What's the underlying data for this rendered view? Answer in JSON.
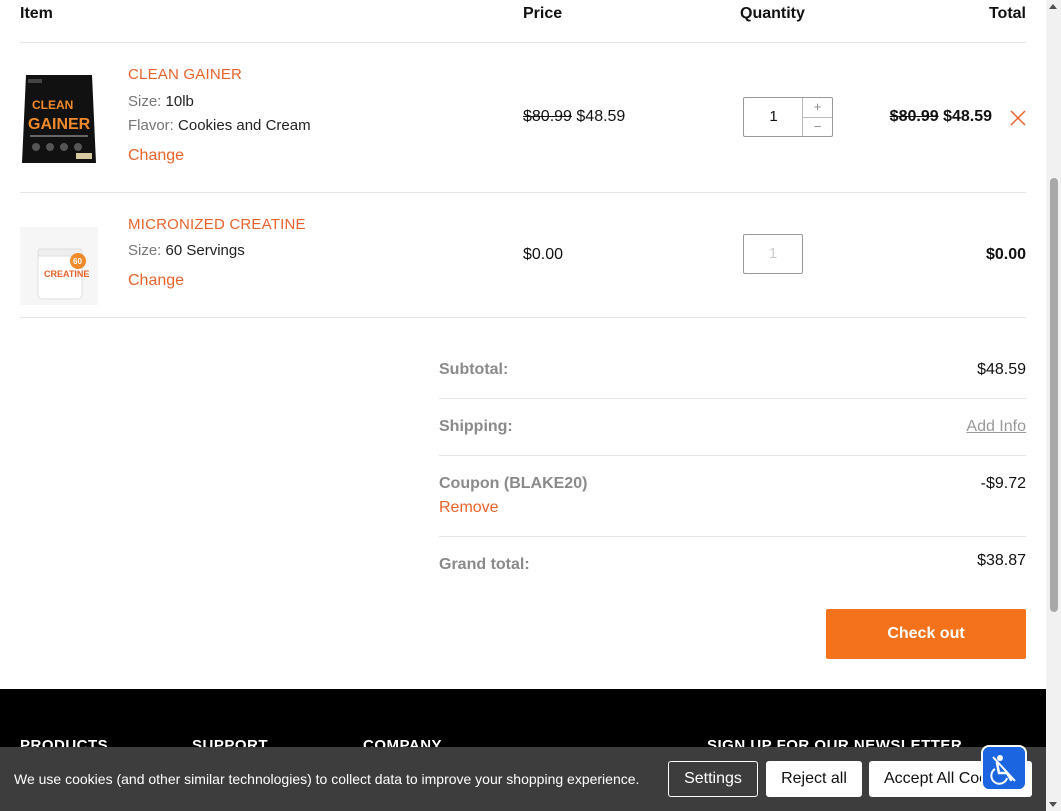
{
  "header": {
    "item": "Item",
    "price": "Price",
    "quantity": "Quantity",
    "total": "Total"
  },
  "items": [
    {
      "name": "CLEAN GAINER",
      "attr1_key": "Size:",
      "attr1_val": "10lb",
      "attr2_key": "Flavor:",
      "attr2_val": "Cookies and Cream",
      "change": "Change",
      "price_old": "$80.99",
      "price_new": "$48.59",
      "quantity": "1",
      "qty_plus": "+",
      "qty_minus": "−",
      "total_old": "$80.99",
      "total_new": "$48.59",
      "image_icon": "product-bag-image",
      "remove_icon": "close-icon"
    },
    {
      "name": "MICRONIZED CREATINE",
      "attr1_key": "Size:",
      "attr1_val": "60 Servings",
      "change": "Change",
      "price": "$0.00",
      "quantity": "1",
      "total": "$0.00",
      "image_icon": "product-tub-image"
    }
  ],
  "summary": {
    "subtotal_label": "Subtotal:",
    "subtotal_value": "$48.59",
    "shipping_label": "Shipping:",
    "shipping_value": "Add Info",
    "coupon_label": "Coupon (BLAKE20)",
    "coupon_remove": "Remove",
    "coupon_value": "-$9.72",
    "grand_label": "Grand total:",
    "grand_value": "$38.87"
  },
  "checkout_label": "Check out",
  "footer": {
    "products": "PRODUCTS",
    "support": "SUPPORT",
    "company": "COMPANY",
    "newsletter": "SIGN UP FOR OUR NEWSLETTER"
  },
  "cookie": {
    "text": "We use cookies (and other similar technologies) to collect data to improve your shopping experience.",
    "settings": "Settings",
    "reject": "Reject all",
    "accept": "Accept All Cookies"
  },
  "colors": {
    "accent": "#e8632b",
    "checkout": "#f5721c",
    "cookie_bar": "#3d3d3d",
    "a11y": "#1b66e0"
  }
}
